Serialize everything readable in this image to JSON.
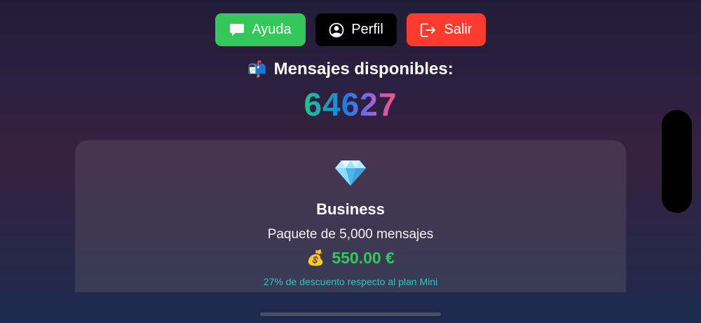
{
  "header": {
    "buttons": [
      {
        "label": "Ayuda",
        "icon": "chat-bubble-icon",
        "color": "#34c759"
      },
      {
        "label": "Perfil",
        "icon": "user-circle-icon",
        "color": "#000000"
      },
      {
        "label": "Salir",
        "icon": "logout-icon",
        "color": "#ff3b30"
      }
    ]
  },
  "messages": {
    "icon": "📬",
    "title": "Mensajes disponibles:",
    "count": "64627"
  },
  "plan": {
    "icon": "💎",
    "name": "Business",
    "description": "Paquete de 5,000 mensajes",
    "price_icon": "💰",
    "price": "550.00 €",
    "discount": "27% de descuento respecto al plan Mini"
  },
  "colors": {
    "accent_green": "#34c759",
    "accent_red": "#ff3b30",
    "discount_teal": "#2ec4c4"
  }
}
